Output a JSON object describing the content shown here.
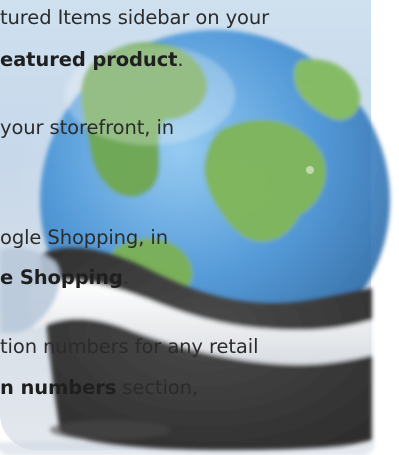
{
  "paragraphs": [
    {
      "lines": [
        {
          "text": "tured Items sidebar on your"
        },
        {
          "bold": "eatured product",
          "after": "."
        }
      ]
    },
    {
      "lines": [
        {
          "text": "your storefront, in"
        }
      ]
    },
    {
      "lines": [
        {
          "text": "ogle Shopping, in"
        },
        {
          "bold": "e Shopping",
          "after": "."
        }
      ]
    },
    {
      "lines": [
        {
          "text": "tion numbers for any retail"
        },
        {
          "bold": "n numbers",
          "after": " section,"
        }
      ]
    }
  ],
  "illustration": {
    "icon": "globe-icon",
    "colors": {
      "ocean": "#3f8fd6",
      "land": "#6fae45",
      "stand": "#ffffff",
      "shadow": "#3c3c3c"
    }
  }
}
